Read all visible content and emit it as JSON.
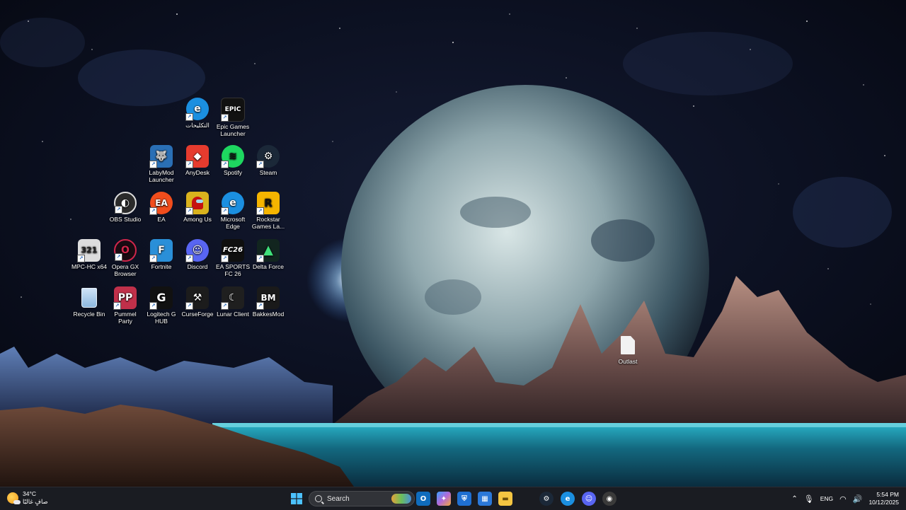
{
  "desktop": {
    "icons": [
      {
        "label": "التكليحات",
        "icon": "edge-icon",
        "color": "#1b8fe0"
      },
      {
        "label": "Epic Games Launcher",
        "icon": "epic-games-icon",
        "color": "#111111"
      },
      {
        "label": "LabyMod Launcher",
        "icon": "labymod-icon",
        "color": "#2a6fb5"
      },
      {
        "label": "AnyDesk",
        "icon": "anydesk-icon",
        "color": "#e63b2e"
      },
      {
        "label": "Spotify",
        "icon": "spotify-icon",
        "color": "#1ed760"
      },
      {
        "label": "Steam",
        "icon": "steam-icon",
        "color": "#1b2838"
      },
      {
        "label": "OBS Studio",
        "icon": "obs-icon",
        "color": "#2b2b2b"
      },
      {
        "label": "EA",
        "icon": "ea-icon",
        "color": "#f14d1c"
      },
      {
        "label": "Among Us",
        "icon": "among-us-icon",
        "color": "#d9b21d"
      },
      {
        "label": "Microsoft Edge",
        "icon": "edge-icon",
        "color": "#1b8fe0"
      },
      {
        "label": "Rockstar Games La...",
        "icon": "rockstar-icon",
        "color": "#f5b400"
      },
      {
        "label": "MPC-HC x64",
        "icon": "mpc-hc-icon",
        "color": "#dddddd"
      },
      {
        "label": "Opera GX Browser",
        "icon": "opera-gx-icon",
        "color": "#1a0b12"
      },
      {
        "label": "Fortnite",
        "icon": "fortnite-icon",
        "color": "#2a8fd8"
      },
      {
        "label": "Discord",
        "icon": "discord-icon",
        "color": "#5865f2"
      },
      {
        "label": "EA SPORTS FC 26",
        "icon": "ea-fc-icon",
        "color": "#0f0f0f"
      },
      {
        "label": "Delta Force",
        "icon": "delta-force-icon",
        "color": "#12251f"
      },
      {
        "label": "Recycle Bin",
        "icon": "recycle-bin-icon",
        "color": "#9fc5e8"
      },
      {
        "label": "Pummel Party",
        "icon": "pummel-party-icon",
        "color": "#c0304a"
      },
      {
        "label": "Logitech G HUB",
        "icon": "logitech-icon",
        "color": "#111111"
      },
      {
        "label": "CurseForge",
        "icon": "curseforge-icon",
        "color": "#1c1c1c"
      },
      {
        "label": "Lunar Client",
        "icon": "lunar-client-icon",
        "color": "#1f1f1f"
      },
      {
        "label": "BakkesMod",
        "icon": "bakkesmod-icon",
        "color": "#1a1a1a"
      },
      {
        "label": "Outlast",
        "icon": "file-icon",
        "color": "#f2f2f2"
      }
    ]
  },
  "taskbar": {
    "weather": {
      "temp": "34°C",
      "condition": "صافٍ غالبًا"
    },
    "search_placeholder": "Search",
    "pinned": [
      {
        "name": "outlook-icon",
        "color": "#0f6cbd",
        "glyph": "O"
      },
      {
        "name": "copilot-icon",
        "color": "#b46ad8",
        "glyph": "✦"
      },
      {
        "name": "windows-security-icon",
        "color": "#1f6fd1",
        "glyph": "⛨"
      },
      {
        "name": "microsoft-store-icon",
        "color": "#2b78d8",
        "glyph": "▦"
      },
      {
        "name": "file-explorer-icon",
        "color": "#f4c542",
        "glyph": "▬"
      },
      {
        "name": "steam-icon",
        "color": "#1b2838",
        "glyph": "S"
      },
      {
        "name": "edge-icon",
        "color": "#1b8fe0",
        "glyph": "e"
      },
      {
        "name": "discord-icon",
        "color": "#5865f2",
        "glyph": "D"
      },
      {
        "name": "chrome-icon",
        "color": "#3a3a3a",
        "glyph": "◉"
      }
    ],
    "tray": {
      "language": "ENG",
      "time": "5:54 PM",
      "date": "10/12/2025"
    }
  }
}
